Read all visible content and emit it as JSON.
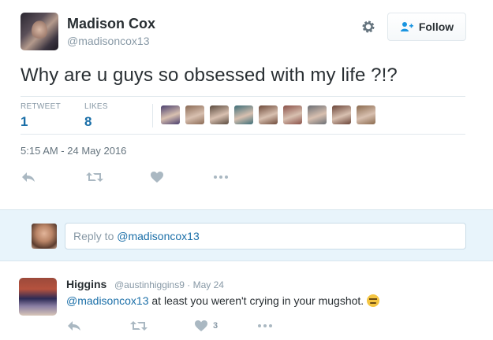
{
  "tweet": {
    "author_name": "Madison Cox",
    "author_handle": "@madisoncox13",
    "follow_label": "Follow",
    "text": "Why are u guys so obsessed with my life ?!?",
    "stats": {
      "retweet_label": "RETWEET",
      "retweet_count": "1",
      "likes_label": "LIKES",
      "likes_count": "8"
    },
    "liker_colors": [
      "#4a3f6e",
      "#8a6a55",
      "#5a4a3e",
      "#3d6e78",
      "#6e4a3a",
      "#8a5048",
      "#6a6e74",
      "#6a4438",
      "#8a6a4e"
    ],
    "timestamp": "5:15 AM - 24 May 2016",
    "icons": [
      "gear-icon",
      "follow-person-icon",
      "reply-icon",
      "retweet-icon",
      "like-icon",
      "more-icon"
    ]
  },
  "reply_box": {
    "prefix": "Reply to ",
    "mention": "@madisoncox13"
  },
  "reply": {
    "name": "Higgins",
    "meta": "@austinhiggins9 · May 24",
    "mention": "@madisoncox13",
    "text": " at least you weren't crying in your mugshot.",
    "like_count": "3",
    "emoji": "unamused-face-emoji"
  },
  "colors": {
    "link": "#1b6fa8",
    "muted": "#8899a6",
    "reply_bg": "#e8f4fb"
  }
}
